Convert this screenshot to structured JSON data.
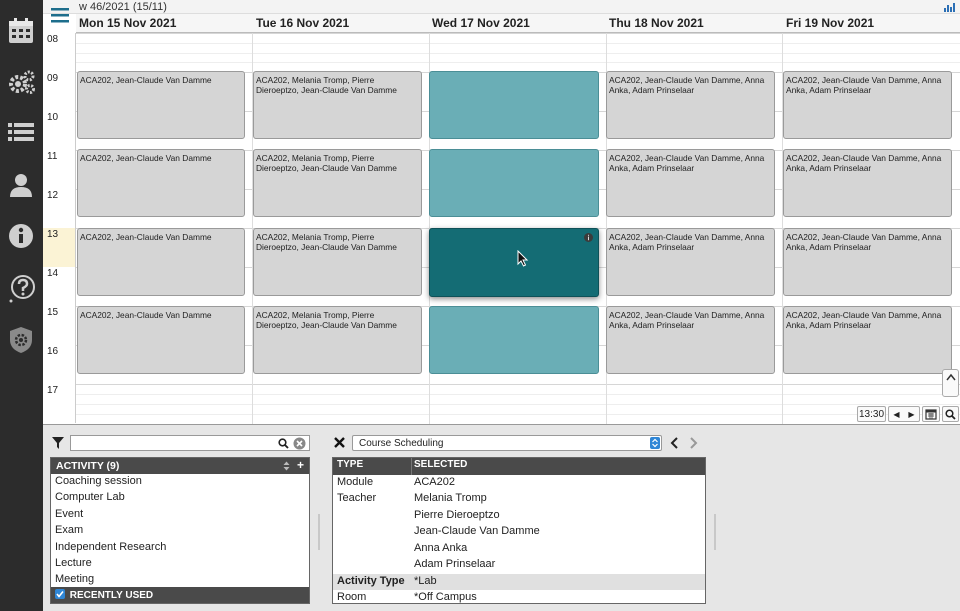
{
  "week_label": "w 46/2021 (15/11)",
  "days": [
    "Mon 15 Nov 2021",
    "Tue 16 Nov 2021",
    "Wed 17 Nov 2021",
    "Thu 18 Nov 2021",
    "Fri 19 Nov 2021"
  ],
  "hours": [
    "08",
    "09",
    "10",
    "11",
    "12",
    "13",
    "14",
    "15",
    "16",
    "17"
  ],
  "events": {
    "mon": "ACA202, Jean-Claude Van Damme",
    "tue": "ACA202, Melania Tromp, Pierre Dieroeptzo, Jean-Claude Van Damme",
    "thu": "ACA202, Jean-Claude Van Damme, Anna Anka, Adam Prinselaar",
    "fri": "ACA202, Jean-Claude Van Damme, Anna Anka, Adam Prinselaar"
  },
  "controls": {
    "time": "13:30",
    "prev": "◀",
    "next": "▶"
  },
  "search": {
    "value": "",
    "placeholder": ""
  },
  "activity_panel": {
    "title": "ACTIVITY (9)",
    "add": "+",
    "items": [
      "Coaching session",
      "Computer Lab",
      "Event",
      "Exam",
      "Independent Research",
      "Lecture",
      "Meeting"
    ],
    "recently_used": "RECENTLY USED"
  },
  "schedule_select": {
    "value": "Course Scheduling"
  },
  "selection_table": {
    "headers": {
      "type": "TYPE",
      "selected": "SELECTED"
    },
    "rows": [
      {
        "type": "Module",
        "selected": "ACA202"
      },
      {
        "type": "Teacher",
        "selected": "Melania Tromp"
      },
      {
        "type": "",
        "selected": "Pierre Dieroeptzo"
      },
      {
        "type": "",
        "selected": "Jean-Claude Van Damme"
      },
      {
        "type": "",
        "selected": "Anna Anka"
      },
      {
        "type": "",
        "selected": "Adam Prinselaar"
      },
      {
        "type": "Activity Type",
        "selected": "*Lab"
      },
      {
        "type": "Room",
        "selected": "*Off Campus"
      }
    ]
  },
  "icons": {
    "sidebar": [
      "calendar-icon",
      "gears-icon",
      "list-icon",
      "user-icon",
      "info-icon",
      "help-icon",
      "shield-icon"
    ]
  },
  "colors": {
    "event_gray": "#d5d5d5",
    "event_teal": "#6aaeb6",
    "event_selected": "#146c74",
    "header_dark": "#4a4a4a",
    "sidebar": "#2c2c2c"
  }
}
